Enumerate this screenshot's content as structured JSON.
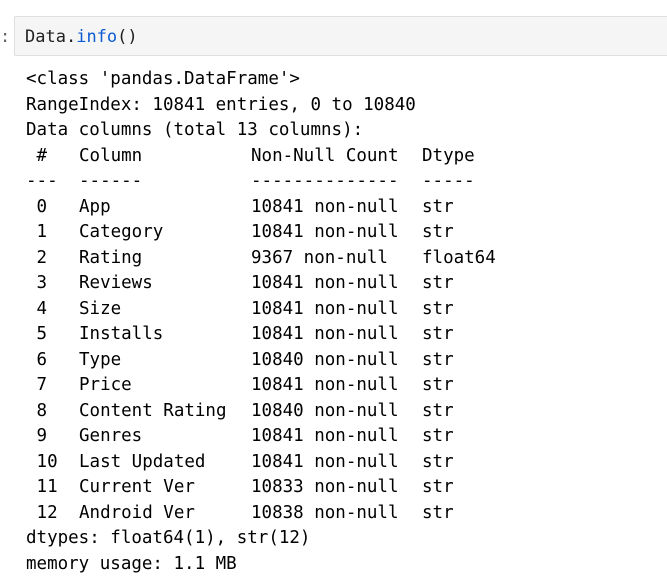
{
  "prompt": ":",
  "cell": {
    "object": "Data",
    "dot": ".",
    "method": "info",
    "parens": "()"
  },
  "output": {
    "class_line": "<class 'pandas.DataFrame'>",
    "range_index": "RangeIndex: 10841 entries, 0 to 10840",
    "columns_summary": "Data columns (total 13 columns):",
    "header": {
      "num": " #",
      "column": "Column",
      "count": "Non-Null Count",
      "dtype": "Dtype"
    },
    "separator": {
      "num": "---",
      "column": "------",
      "count": "--------------",
      "dtype": "-----"
    },
    "rows": [
      {
        "num": " 0",
        "column": "App",
        "count": "10841 non-null",
        "dtype": "str"
      },
      {
        "num": " 1",
        "column": "Category",
        "count": "10841 non-null",
        "dtype": "str"
      },
      {
        "num": " 2",
        "column": "Rating",
        "count": "9367 non-null",
        "dtype": "float64"
      },
      {
        "num": " 3",
        "column": "Reviews",
        "count": "10841 non-null",
        "dtype": "str"
      },
      {
        "num": " 4",
        "column": "Size",
        "count": "10841 non-null",
        "dtype": "str"
      },
      {
        "num": " 5",
        "column": "Installs",
        "count": "10841 non-null",
        "dtype": "str"
      },
      {
        "num": " 6",
        "column": "Type",
        "count": "10840 non-null",
        "dtype": "str"
      },
      {
        "num": " 7",
        "column": "Price",
        "count": "10841 non-null",
        "dtype": "str"
      },
      {
        "num": " 8",
        "column": "Content Rating",
        "count": "10840 non-null",
        "dtype": "str"
      },
      {
        "num": " 9",
        "column": "Genres",
        "count": "10841 non-null",
        "dtype": "str"
      },
      {
        "num": " 10",
        "column": "Last Updated",
        "count": "10841 non-null",
        "dtype": "str"
      },
      {
        "num": " 11",
        "column": "Current Ver",
        "count": "10833 non-null",
        "dtype": "str"
      },
      {
        "num": " 12",
        "column": "Android Ver",
        "count": "10838 non-null",
        "dtype": "str"
      }
    ],
    "dtypes_line": "dtypes: float64(1), str(12)",
    "memory_line": "memory usage: 1.1 MB"
  },
  "colors": {
    "cell_background": "#f5f5f5",
    "method": "#0b5bd3",
    "text": "#000000"
  }
}
